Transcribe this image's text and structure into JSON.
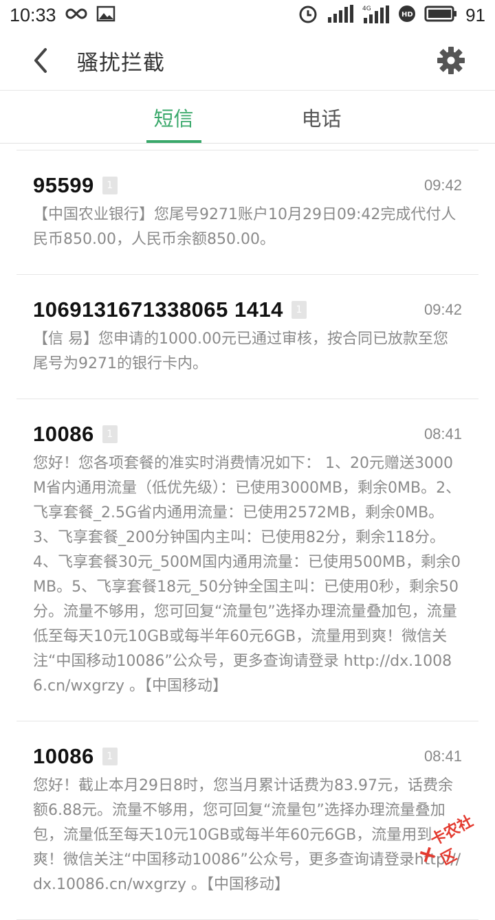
{
  "status_bar": {
    "time": "10:33",
    "battery": "91",
    "network": "4G"
  },
  "app_bar": {
    "title": "骚扰拦截",
    "back_icon": "chevron-left-icon",
    "settings_icon": "gear-icon"
  },
  "tabs": [
    {
      "label": "短信",
      "active": true
    },
    {
      "label": "电话",
      "active": false
    }
  ],
  "messages": [
    {
      "sender": "95599",
      "sim": "1",
      "time": "09:42",
      "body": "【中国农业银行】您尾号9271账户10月29日09:42完成代付人民币850.00，人民币余额850.00。"
    },
    {
      "sender": "1069131671338065 1414",
      "sim": "1",
      "time": "09:42",
      "body": "【信 易】您申请的1000.00元已通过审核，按合同已放款至您尾号为9271的银行卡内。"
    },
    {
      "sender": "10086",
      "sim": "1",
      "time": "08:41",
      "body": "您好！您各项套餐的准实时消费情况如下： 1、20元赠送3000M省内通用流量（低优先级）：已使用3000MB，剩余0MB。2、飞享套餐_2.5G省内通用流量：已使用2572MB，剩余0MB。3、飞享套餐_200分钟国内主叫：已使用82分，剩余118分。4、飞享套餐30元_500M国内通用流量：已使用500MB，剩余0MB。5、飞享套餐18元_50分钟全国主叫：已使用0秒，剩余50分。流量不够用，您可回复“流量包”选择办理流量叠加包，流量低至每天10元10GB或每半年60元6GB，流量用到爽！微信关注“中国移动10086”公众号，更多查询请登录 http://dx.10086.cn/wxgrzy 。【中国移动】"
    },
    {
      "sender": "10086",
      "sim": "1",
      "time": "08:41",
      "body": "您好！截止本月29日8时，您当月累计话费为83.97元，话费余额6.88元。流量不够用，您可回复“流量包”选择办理流量叠加包，流量低至每天10元10GB或每半年60元6GB，流量用到爽！微信关注“中国移动10086”公众号，更多查询请登录http://dx.10086.cn/wxgrzy 。【中国移动】"
    }
  ],
  "watermark": "卡农社区",
  "colors": {
    "accent": "#39a86a",
    "body_text": "#8a8a8a",
    "divider": "#e6e6e6"
  }
}
